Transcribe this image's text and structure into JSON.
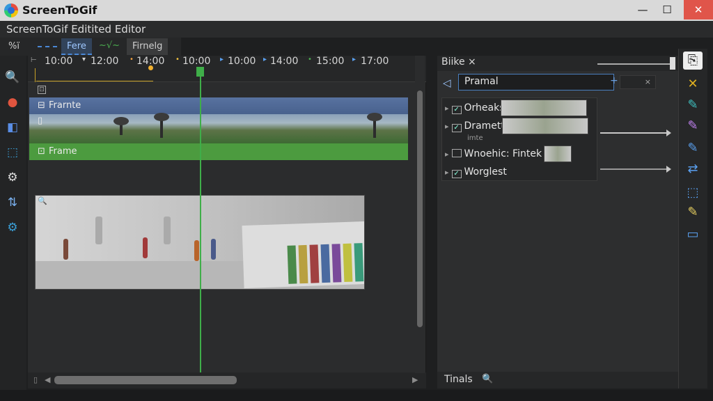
{
  "window": {
    "app_title": "ScreenToGif",
    "editor_title": "ScreenToGif  Editited Editor",
    "min_glyph": "—",
    "max_glyph": "☐",
    "close_glyph": "✕"
  },
  "tabs": {
    "tab_a": "%ï",
    "tab_b": "Fere",
    "tab_wave": "~√~",
    "tab_c": "Firnelg"
  },
  "left_tools": [
    {
      "icon": "search-icon",
      "glyph": "🔍",
      "color": "#3fae49"
    },
    {
      "icon": "palette-icon",
      "glyph": "●",
      "color": "#e0553f"
    },
    {
      "icon": "record-icon",
      "glyph": "◧",
      "color": "#5a8ee6"
    },
    {
      "icon": "crop-icon",
      "glyph": "⬚",
      "color": "#3ba0d8"
    },
    {
      "icon": "gear-outline-icon",
      "glyph": "⚙",
      "color": "#dddddd"
    },
    {
      "icon": "edit-timeline-icon",
      "glyph": "⇅",
      "color": "#7ab0ee"
    },
    {
      "icon": "settings-icon",
      "glyph": "⚙",
      "color": "#3ba0d8"
    }
  ],
  "timeline": {
    "ticks": [
      "10:00",
      "12:00",
      "14:00",
      "10:00",
      "10:00",
      "14:00",
      "15:00",
      "17:00"
    ],
    "tick_prefixes": [
      "",
      "▾",
      "•",
      "•",
      "▸",
      "▸",
      "•",
      "▸"
    ],
    "tracks": {
      "top_label": "Frarnte",
      "bottom_label": "Frame"
    },
    "row_glyph_1": "⊡",
    "row_glyph_2": "▯",
    "zoom_glyph": "🔍",
    "scroll_left": "◀",
    "scroll_right": "▶",
    "scroll_start": "▯"
  },
  "properties": {
    "tab_label": "Biike ×",
    "back_glyph": "◁",
    "search_value": "Pramal",
    "search_plus": "+",
    "clear_glyph": "×",
    "items": [
      {
        "label": "Orheaks",
        "checked": "✓"
      },
      {
        "label": "Dramett",
        "sub": "imte",
        "checked": "✓"
      },
      {
        "label": "Wnoehic: Fintek",
        "checked": ""
      },
      {
        "label": "Worglest",
        "checked": "✓"
      }
    ],
    "footer_label": "Tinals",
    "footer_icon_glyph": "🔍"
  },
  "right_tools": [
    {
      "icon": "export-icon",
      "glyph": "⎘",
      "color": "#222222"
    },
    {
      "icon": "cross-tool-icon",
      "glyph": "✕",
      "color": "#e0b020"
    },
    {
      "icon": "pen-icon",
      "glyph": "✎",
      "color": "#3fc0c0"
    },
    {
      "icon": "pencil-icon",
      "glyph": "✎",
      "color": "#c080f0"
    },
    {
      "icon": "brush-icon",
      "glyph": "✎",
      "color": "#5aa0f0"
    },
    {
      "icon": "resize-icon",
      "glyph": "⇄",
      "color": "#5aa0f0"
    },
    {
      "icon": "select-icon",
      "glyph": "⬚",
      "color": "#5aa0f0"
    },
    {
      "icon": "highlighter-icon",
      "glyph": "✎",
      "color": "#e8d060"
    },
    {
      "icon": "monitor-icon",
      "glyph": "▭",
      "color": "#5aa0f0"
    }
  ]
}
